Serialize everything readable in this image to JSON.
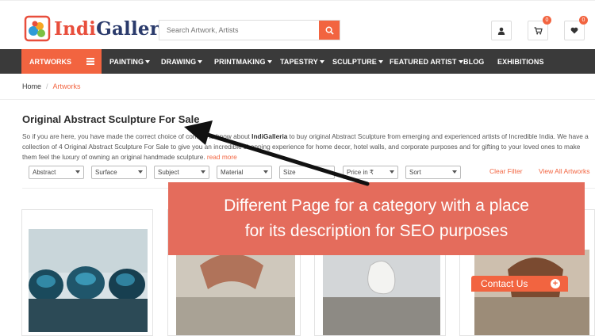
{
  "brand": {
    "name_part1": "Indi",
    "name_part2": "Galleria",
    "accent": "#f26440",
    "nav_bg": "#3a3a3a",
    "overlay_bg": "#e46c5c"
  },
  "search": {
    "placeholder": "Search Artwork, Artists",
    "icon": "search-icon"
  },
  "header_icons": [
    {
      "name": "user-icon",
      "badge": ""
    },
    {
      "name": "cart-icon",
      "badge": "0"
    },
    {
      "name": "heart-icon",
      "badge": "0"
    }
  ],
  "nav": {
    "artworks": "ARTWORKS",
    "items": [
      "PAINTING",
      "DRAWING",
      "PRINTMAKING",
      "TAPESTRY",
      "SCULPTURE",
      "FEATURED ARTIST",
      "BLOG",
      "EXHIBITIONS"
    ]
  },
  "breadcrumb": {
    "home": "Home",
    "current": "Artworks"
  },
  "page": {
    "title": "Original Abstract Sculpture For Sale",
    "desc_pre": "So if you are here, you have made the correct choice of coming to know about ",
    "desc_brand": "IndiGalleria",
    "desc_post": " to buy original Abstract Sculpture from emerging and experienced artists of Incredible India. We have a collection of 4 Original Abstract Sculpture For Sale to give you an incredible shopping experience for home decor, hotel walls, and corporate purposes and for gifting to your loved ones to make them feel the luxury of owning an original handmade sculpture.",
    "read_more": "read more"
  },
  "filters": {
    "selects": [
      "Abstract",
      "Surface",
      "Subject",
      "Material",
      "Size",
      "Price in ₹",
      "Sort"
    ],
    "clear": "Clear Filter",
    "view_all": "View All Artworks"
  },
  "overlay": {
    "line1": "Different Page for a category with a place",
    "line2": "for its description for SEO purposes"
  },
  "contact": {
    "label": "Contact Us",
    "plus": "+"
  }
}
